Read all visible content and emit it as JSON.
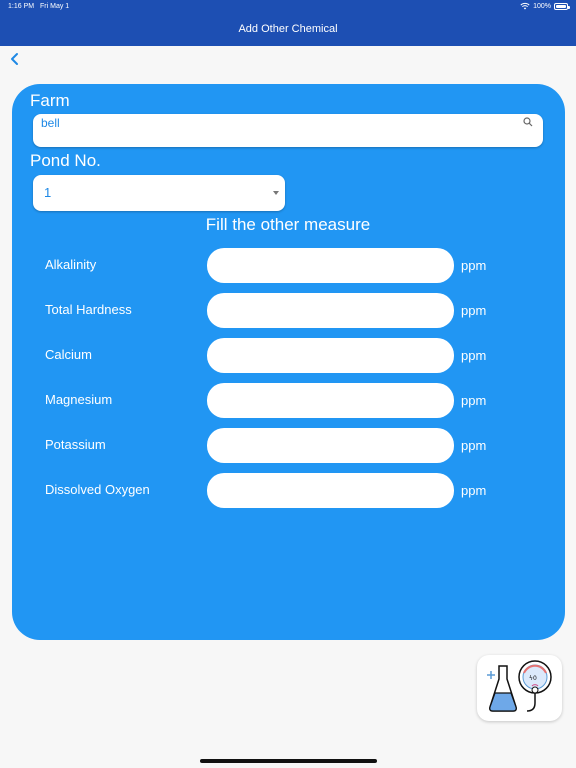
{
  "status_bar": {
    "time": "1:16 PM",
    "date": "Fri May 1",
    "battery": "100%"
  },
  "nav": {
    "title": "Add Other Chemical"
  },
  "form": {
    "farm_label": "Farm",
    "farm_value": "bell",
    "pond_label": "Pond No.",
    "pond_value": "1",
    "section_title": "Fill the other measure",
    "measures": [
      {
        "label": "Alkalinity",
        "value": "",
        "unit": "ppm"
      },
      {
        "label": "Total Hardness",
        "value": "",
        "unit": "ppm"
      },
      {
        "label": "Calcium",
        "value": "",
        "unit": "ppm"
      },
      {
        "label": "Magnesium",
        "value": "",
        "unit": "ppm"
      },
      {
        "label": "Potassium",
        "value": "",
        "unit": "ppm"
      },
      {
        "label": "Dissolved Oxygen",
        "value": "",
        "unit": "ppm"
      }
    ]
  },
  "colors": {
    "header": "#1d4fb3",
    "card": "#2196f3",
    "accent_text": "#1e88e5"
  },
  "icons": [
    "wifi-icon",
    "battery-icon",
    "back-chevron-icon",
    "search-icon",
    "dropdown-caret-icon",
    "app-logo-icon"
  ]
}
